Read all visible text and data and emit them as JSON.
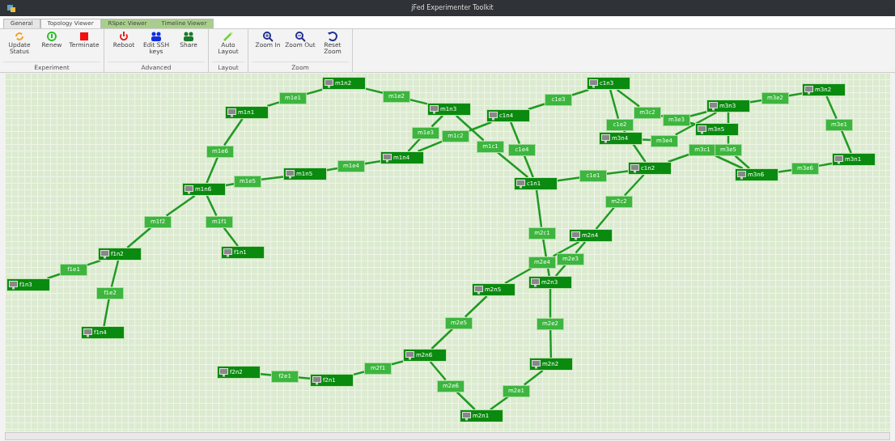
{
  "window": {
    "title": "jFed Experimenter Toolkit"
  },
  "tabs": [
    {
      "label": "General",
      "selected": false
    },
    {
      "label": "Topology Viewer",
      "selected": true
    },
    {
      "label": "RSpec Viewer",
      "selected": false
    },
    {
      "label": "Timeline Viewer",
      "selected": false
    }
  ],
  "toolbar_groups": [
    {
      "label": "Experiment",
      "buttons": [
        {
          "label": "Update Status",
          "kind": "refresh"
        },
        {
          "label": "Renew",
          "kind": "renew"
        },
        {
          "label": "Terminate",
          "kind": "stop"
        }
      ]
    },
    {
      "label": "Advanced",
      "buttons": [
        {
          "label": "Reboot",
          "kind": "power"
        },
        {
          "label": "Edit SSH keys",
          "kind": "users"
        },
        {
          "label": "Share",
          "kind": "share"
        }
      ]
    },
    {
      "label": "Layout",
      "buttons": [
        {
          "label": "Auto Layout",
          "kind": "wand"
        }
      ]
    },
    {
      "label": "Zoom",
      "buttons": [
        {
          "label": "Zoom In",
          "kind": "zoomin"
        },
        {
          "label": "Zoom Out",
          "kind": "zoomout"
        },
        {
          "label": "Reset Zoom",
          "kind": "reset"
        }
      ]
    }
  ],
  "topology": {
    "nodes": [
      {
        "label": "m1n1"
      },
      {
        "label": "m1n2"
      },
      {
        "label": "m1n3"
      },
      {
        "label": "m1n4"
      },
      {
        "label": "m1n5"
      },
      {
        "label": "m1n6"
      },
      {
        "label": "f1n2"
      },
      {
        "label": "f1n3"
      },
      {
        "label": "f1n4"
      },
      {
        "label": "f1n1"
      },
      {
        "label": "c1n4"
      },
      {
        "label": "c1n3"
      },
      {
        "label": "c1n1"
      },
      {
        "label": "c1n2"
      },
      {
        "label": "m3n4"
      },
      {
        "label": "m3n5"
      },
      {
        "label": "m3n3"
      },
      {
        "label": "m3n2"
      },
      {
        "label": "m3n1"
      },
      {
        "label": "m3n6"
      },
      {
        "label": "m2n4"
      },
      {
        "label": "m2n3"
      },
      {
        "label": "m2n5"
      },
      {
        "label": "m2n6"
      },
      {
        "label": "m2n2"
      },
      {
        "label": "m2n1"
      },
      {
        "label": "f2n1"
      },
      {
        "label": "f2n2"
      }
    ],
    "links": [
      {
        "label": "m1e1"
      },
      {
        "label": "m1e2"
      },
      {
        "label": "m1e3"
      },
      {
        "label": "m1c2"
      },
      {
        "label": "m1c1"
      },
      {
        "label": "m1e4"
      },
      {
        "label": "m1e5"
      },
      {
        "label": "m1e6"
      },
      {
        "label": "m1f2"
      },
      {
        "label": "m1f1"
      },
      {
        "label": "f1e1"
      },
      {
        "label": "f1e2"
      },
      {
        "label": "c1e3"
      },
      {
        "label": "c1e4"
      },
      {
        "label": "c1e1"
      },
      {
        "label": "m3c2"
      },
      {
        "label": "c1e2"
      },
      {
        "label": "m3e4"
      },
      {
        "label": "m3e3"
      },
      {
        "label": "m3e2"
      },
      {
        "label": "m3e1"
      },
      {
        "label": "m3e6"
      },
      {
        "label": "m3c1"
      },
      {
        "label": "m3e5"
      },
      {
        "label": "m2c2"
      },
      {
        "label": "m2c1"
      },
      {
        "label": "m2e4"
      },
      {
        "label": "m2e3"
      },
      {
        "label": "m2e2"
      },
      {
        "label": "m2e1"
      },
      {
        "label": "m2e6"
      },
      {
        "label": "m2e5"
      },
      {
        "label": "m2f1"
      },
      {
        "label": "f2e1"
      }
    ]
  }
}
